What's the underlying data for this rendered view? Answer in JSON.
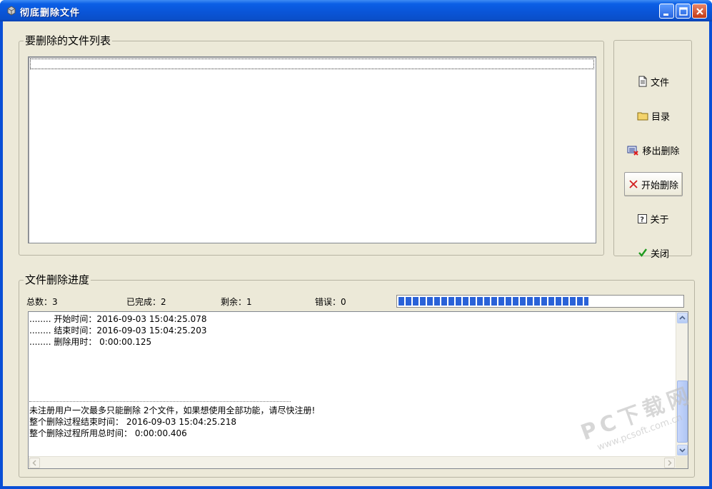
{
  "window": {
    "title": "彻底删除文件"
  },
  "file_group": {
    "title": "要删除的文件列表",
    "items": []
  },
  "buttons": {
    "file": "文件",
    "folder": "目录",
    "remove": "移出删除",
    "start": "开始删除",
    "about": "关于",
    "close": "关闭"
  },
  "progress_group": {
    "title": "文件删除进度",
    "total_label": "总数：",
    "total": "3",
    "done_label": "已完成：",
    "done": "2",
    "remaining_label": "剩余：",
    "remaining": "1",
    "errors_label": "错误：",
    "errors": "0",
    "progress_fraction": 0.67
  },
  "log": {
    "lines": [
      "........ 开始时间：2016-09-03 15:04:25.078",
      "........ 结束时间：2016-09-03 15:04:25.203",
      "........ 删除用时： 0:00:00.125"
    ],
    "summary": [
      "未注册用户一次最多只能删除 2个文件，如果想使用全部功能，请尽快注册!",
      "整个删除过程结束时间： 2016-09-03 15:04:25.218",
      "整个删除过程所用总时间： 0:00:00.406"
    ]
  },
  "watermark": {
    "big": "PC下载网",
    "small": "www.pcsoft.com.cn"
  },
  "colors": {
    "titlebar": "#0a55d8",
    "face": "#ece9d8",
    "progress": "#2a62d8"
  }
}
